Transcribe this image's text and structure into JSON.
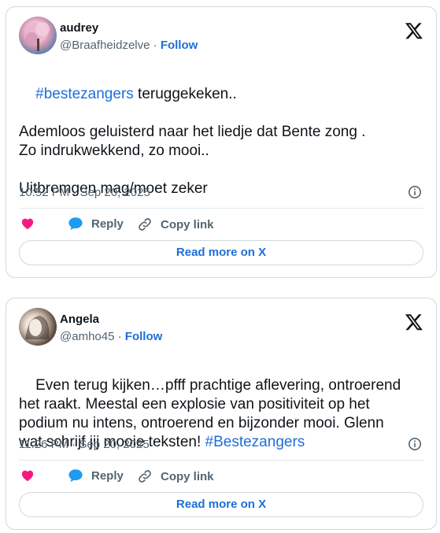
{
  "tweets": [
    {
      "name": "audrey",
      "handle": "@Braafheidzelve",
      "separator": "·",
      "follow_label": "Follow",
      "text_parts": [
        {
          "text": "#bestezangers",
          "hashtag": true
        },
        {
          "text": " teruggekeken..\n\nAdemloos geluisterd naar het liedje dat Bente zong .\nZo indrukwekkend, zo mooi..\n\nUitbremgen mag/moet zeker",
          "hashtag": false
        }
      ],
      "timestamp": "10:52 PM · Sep 20, 2025",
      "reply_label": "Reply",
      "copy_link_label": "Copy link",
      "read_more_label": "Read more on X"
    },
    {
      "name": "Angela",
      "handle": "@amho45",
      "separator": "·",
      "follow_label": "Follow",
      "text_parts": [
        {
          "text": "Even terug kijken…pfff prachtige aflevering, ontroerend\nhet raakt. Meestal een explosie van positiviteit op het\npodium nu intens, ontroerend en bijzonder mooi. Glenn\nwat schrijf jij mooie teksten! ",
          "hashtag": false
        },
        {
          "text": "#Bestezangers",
          "hashtag": true
        }
      ],
      "timestamp": "11:26 PM · Sep 20, 2025",
      "reply_label": "Reply",
      "copy_link_label": "Copy link",
      "read_more_label": "Read more on X"
    }
  ],
  "colors": {
    "accent": "#1d6fd8",
    "heart": "#f91880",
    "reply_bubble": "#1d9bf0",
    "muted_text": "#536471",
    "border": "#cfd9de"
  },
  "icons": [
    "x-logo-icon",
    "info-icon",
    "heart-icon",
    "reply-icon",
    "link-icon"
  ]
}
